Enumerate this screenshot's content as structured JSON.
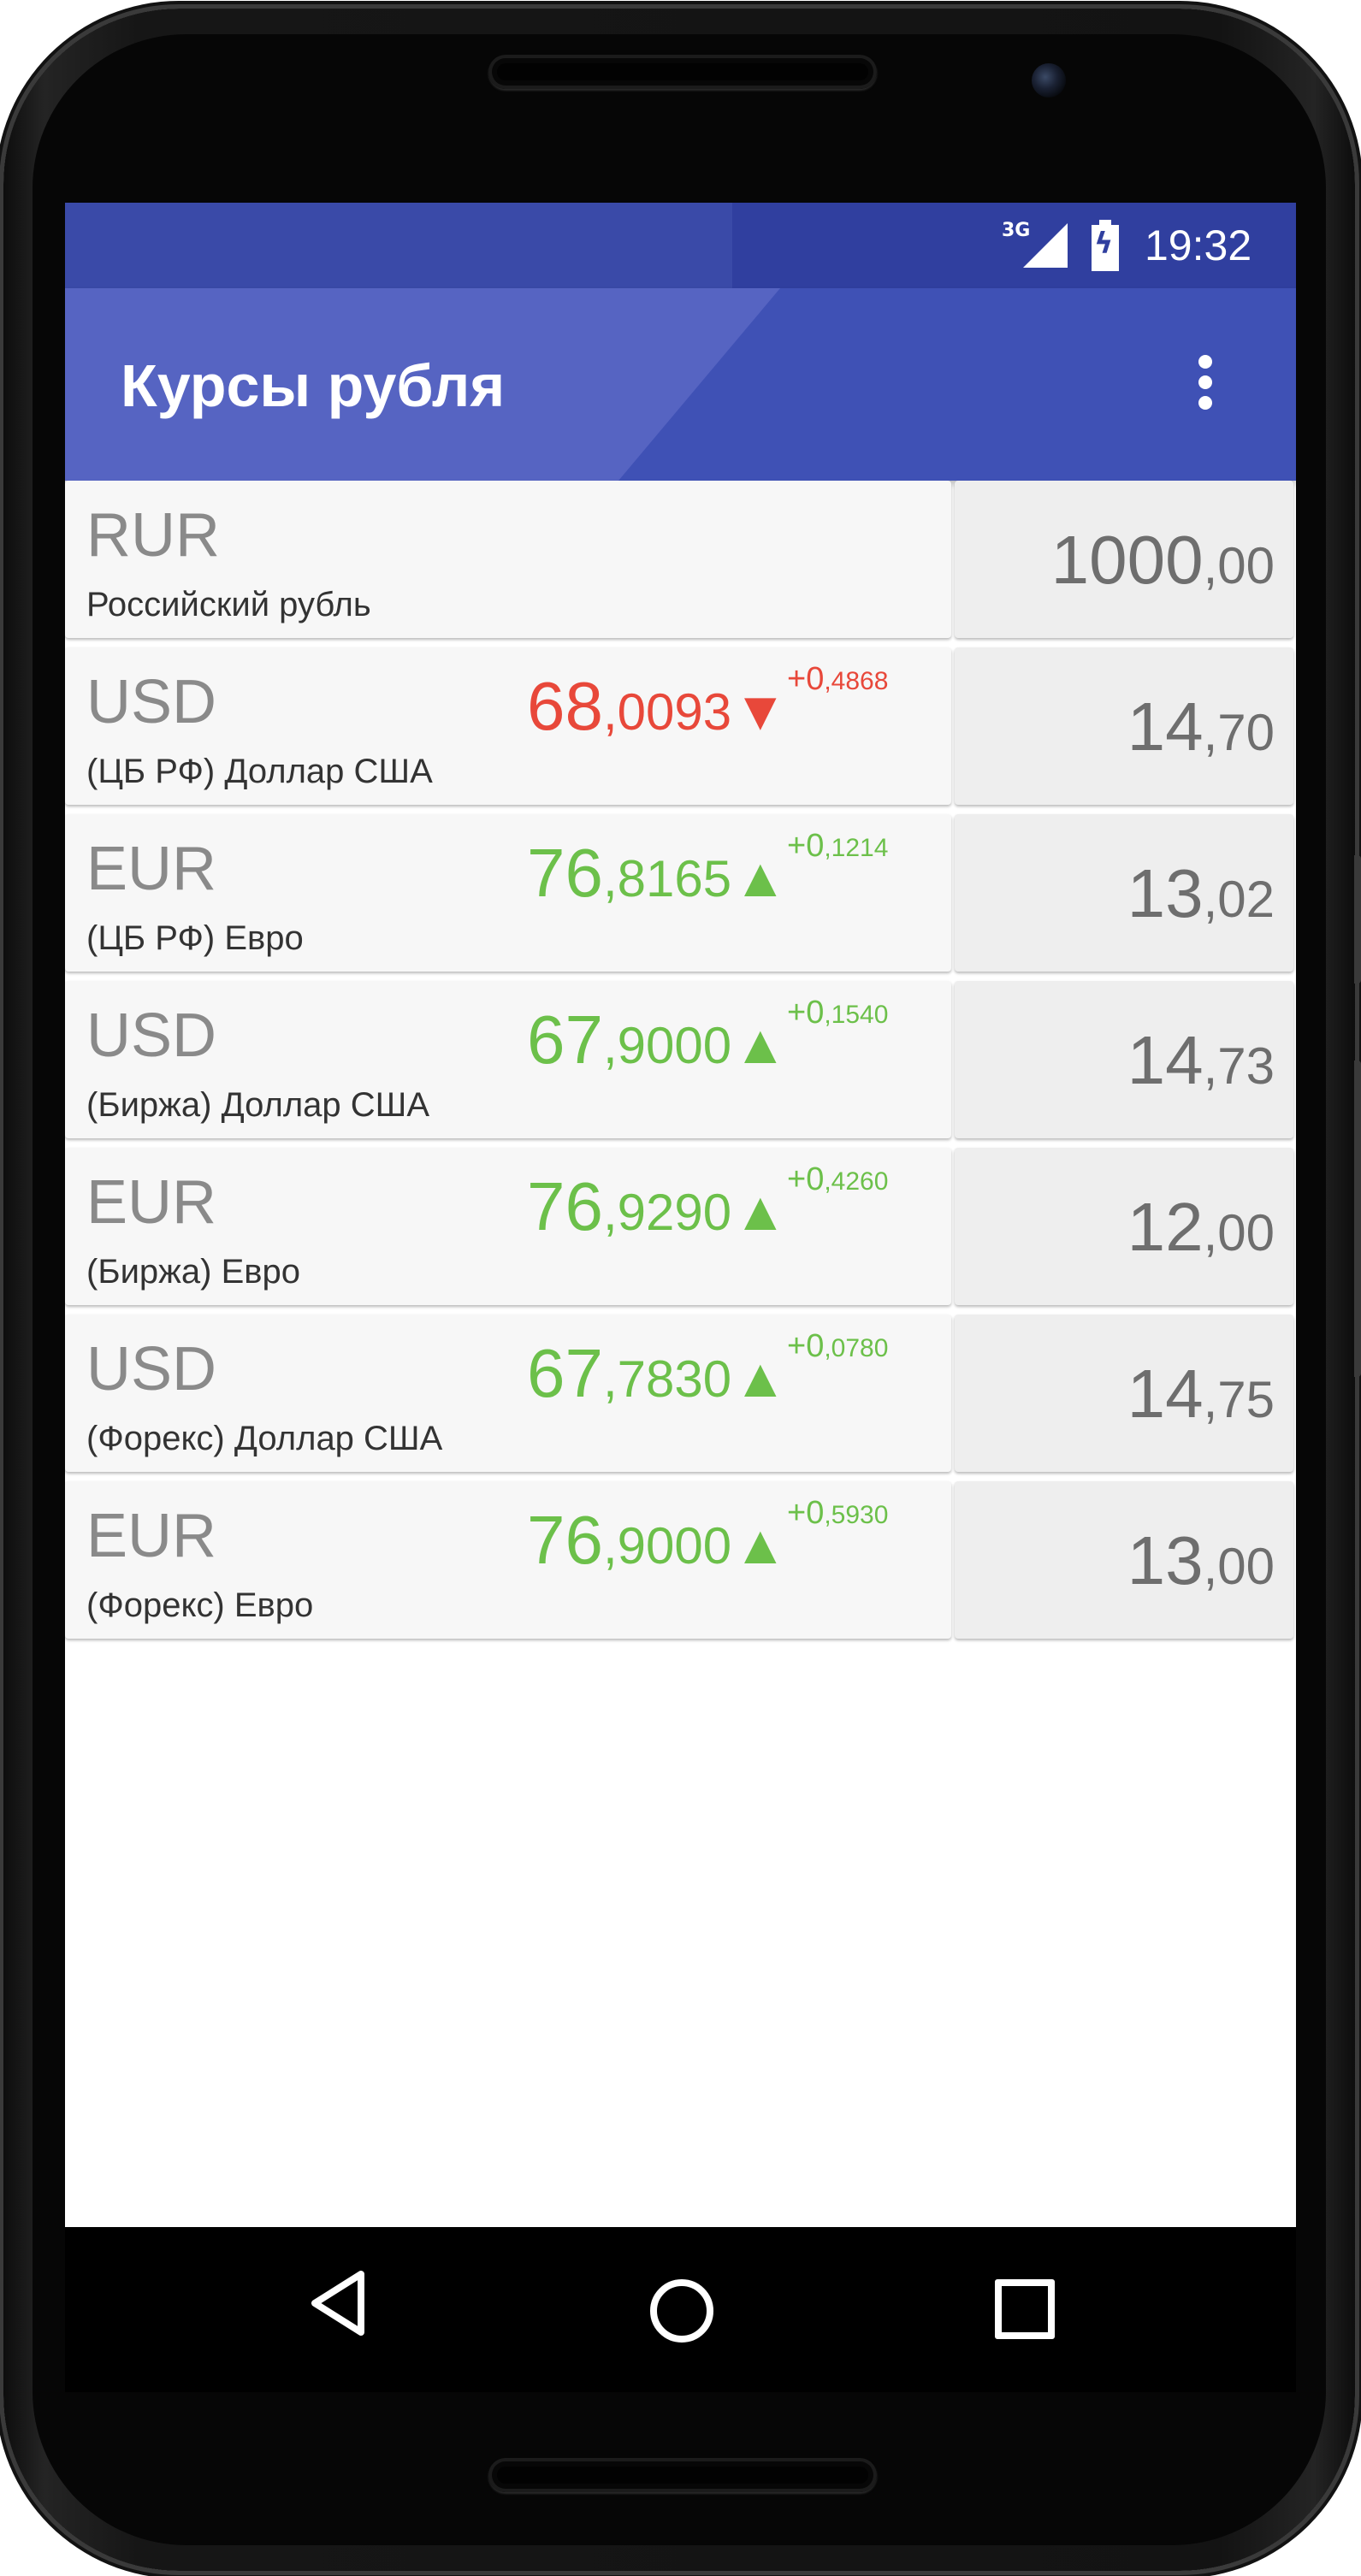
{
  "status_bar": {
    "network": "3G",
    "time": "19:32"
  },
  "app_bar": {
    "title": "Курсы рубля"
  },
  "colors": {
    "primary": "#3f51b5",
    "primary_dark": "#303f9f",
    "rate_up": "#6cc04a",
    "rate_down": "#e8483a"
  },
  "rates": [
    {
      "code": "RUR",
      "name": "Российский рубль",
      "rate_int": "",
      "rate_frac": "",
      "arrow": "",
      "trend": "none",
      "change_int": "",
      "change_frac": "",
      "amount_int": "1000",
      "amount_frac": ",00"
    },
    {
      "code": "USD",
      "name": "(ЦБ РФ) Доллар США",
      "rate_int": "68",
      "rate_frac": ",0093",
      "arrow": "▼",
      "trend": "down",
      "change_int": "+0",
      "change_frac": ",4868",
      "amount_int": "14",
      "amount_frac": ",70"
    },
    {
      "code": "EUR",
      "name": "(ЦБ РФ) Евро",
      "rate_int": "76",
      "rate_frac": ",8165",
      "arrow": "▲",
      "trend": "up",
      "change_int": "+0",
      "change_frac": ",1214",
      "amount_int": "13",
      "amount_frac": ",02"
    },
    {
      "code": "USD",
      "name": "(Биржа) Доллар США",
      "rate_int": "67",
      "rate_frac": ",9000",
      "arrow": "▲",
      "trend": "up",
      "change_int": "+0",
      "change_frac": ",1540",
      "amount_int": "14",
      "amount_frac": ",73"
    },
    {
      "code": "EUR",
      "name": "(Биржа) Евро",
      "rate_int": "76",
      "rate_frac": ",9290",
      "arrow": "▲",
      "trend": "up",
      "change_int": "+0",
      "change_frac": ",4260",
      "amount_int": "12",
      "amount_frac": ",00"
    },
    {
      "code": "USD",
      "name": "(Форекс) Доллар США",
      "rate_int": "67",
      "rate_frac": ",7830",
      "arrow": "▲",
      "trend": "up",
      "change_int": "+0",
      "change_frac": ",0780",
      "amount_int": "14",
      "amount_frac": ",75"
    },
    {
      "code": "EUR",
      "name": "(Форекс) Евро",
      "rate_int": "76",
      "rate_frac": ",9000",
      "arrow": "▲",
      "trend": "up",
      "change_int": "+0",
      "change_frac": ",5930",
      "amount_int": "13",
      "amount_frac": ",00"
    }
  ],
  "nav_bar": {
    "buttons": [
      "back-icon",
      "home-icon",
      "recents-icon"
    ]
  }
}
